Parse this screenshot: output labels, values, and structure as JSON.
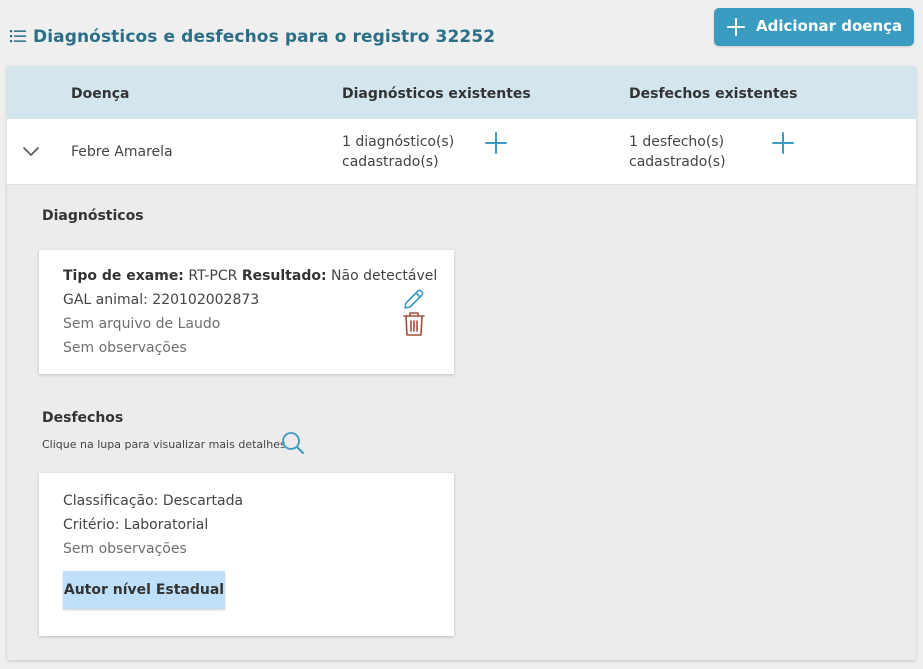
{
  "header": {
    "title": "Diagnósticos e desfechos para o registro 32252",
    "add_button_label": "Adicionar doença"
  },
  "table": {
    "columns": [
      "Doença",
      "Diagnósticos existentes",
      "Desfechos existentes"
    ],
    "row": {
      "disease": "Febre Amarela",
      "diagnoses_line1": "1 diagnóstico(s)",
      "diagnoses_line2": "cadastrado(s)",
      "outcomes_line1": "1 desfecho(s)",
      "outcomes_line2": "cadastrado(s)"
    }
  },
  "diagnoses": {
    "section_title": "Diagnósticos",
    "card": {
      "exam_type_label": "Tipo de exame:",
      "exam_type_value": "RT-PCR",
      "result_label": "Resultado:",
      "result_value": "Não detectável",
      "gal_label": "GAL animal:",
      "gal_value": "220102002873",
      "report": "Sem arquivo de Laudo",
      "notes": "Sem observações"
    }
  },
  "outcomes": {
    "section_title": "Desfechos",
    "hint": "Clique na lupa para visualizar mais detalhes",
    "card": {
      "classification": "Classificação: Descartada",
      "criterion": "Critério: Laboratorial",
      "notes": "Sem observações",
      "author_button": "Autor nível Estadual"
    }
  },
  "colors": {
    "accent": "#3a9cc0",
    "title": "#2a6f86",
    "table_header": "#d3e6ee",
    "edit_icon": "#3a9cc0",
    "delete_icon": "#a0503a",
    "author_button": "#bfe0fa"
  },
  "icons": [
    "list-icon",
    "plus-icon",
    "chevron-down-icon",
    "pencil-icon",
    "trash-icon",
    "search-icon"
  ]
}
